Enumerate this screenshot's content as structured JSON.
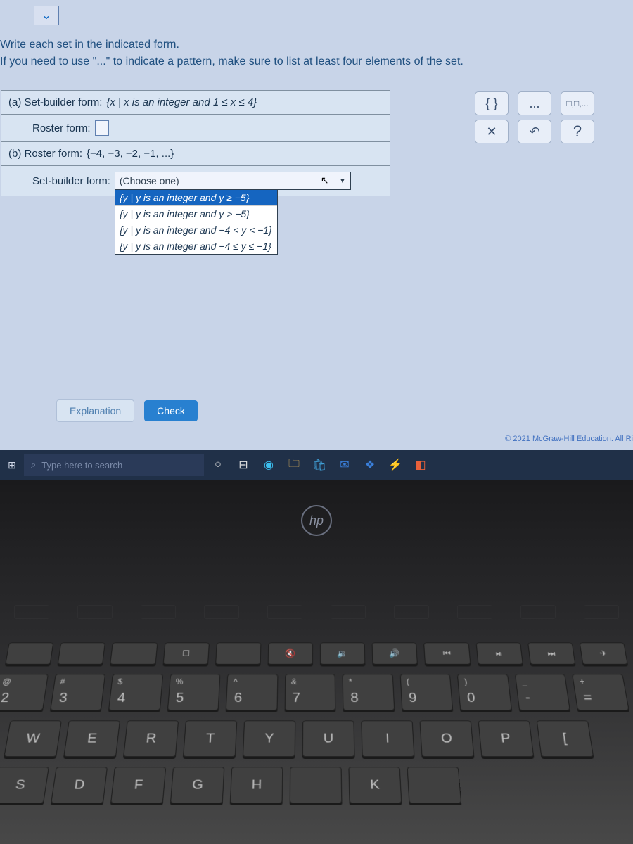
{
  "instructions": {
    "line1_pre": "Write each ",
    "line1_underline": "set",
    "line1_post": " in the indicated form.",
    "line2": "If you need to use \"...\" to indicate a pattern, make sure to list at least four elements of the set."
  },
  "parts": {
    "a_label": "(a)  Set-builder form:",
    "a_value": "{x | x is an integer and 1 ≤ x ≤ 4}",
    "a_roster_label": "Roster form:",
    "b_label": "(b)  Roster form:",
    "b_value": "{−4, −3, −2, −1, ...}",
    "b_sb_label": "Set-builder form:"
  },
  "dropdown": {
    "selected": "(Choose one)",
    "options": [
      "{y | y is an integer and y ≥ −5}",
      "{y | y is an integer and y > −5}",
      "{y | y is an integer and −4 < y < −1}",
      "{y | y is an integer and −4 ≤ y ≤ −1}"
    ]
  },
  "tools": {
    "set_braces": "{ }",
    "ellipsis": "...",
    "pair": "□,□,...",
    "clear": "✕",
    "reset": "↶",
    "help": "?"
  },
  "buttons": {
    "explanation": "Explanation",
    "check": "Check"
  },
  "copyright": "© 2021 McGraw-Hill Education. All Ri",
  "taskbar": {
    "search_placeholder": "Type here to search"
  },
  "hp": "hp",
  "keys": {
    "fn_row": [
      "",
      "",
      "",
      "☐",
      "",
      "🔇",
      "🔉",
      "🔊",
      "⏮",
      "⏯",
      "⏭",
      "✈"
    ],
    "num_row": [
      {
        "top": "@",
        "main": "2"
      },
      {
        "top": "#",
        "main": "3"
      },
      {
        "top": "$",
        "main": "4"
      },
      {
        "top": "%",
        "main": "5"
      },
      {
        "top": "^",
        "main": "6"
      },
      {
        "top": "&",
        "main": "7"
      },
      {
        "top": "*",
        "main": "8"
      },
      {
        "top": "(",
        "main": "9"
      },
      {
        "top": ")",
        "main": "0"
      },
      {
        "top": "_",
        "main": "-"
      },
      {
        "top": "+",
        "main": "="
      }
    ],
    "letter_row1": [
      "W",
      "E",
      "R",
      "T",
      "Y",
      "U",
      "I",
      "O",
      "P",
      "["
    ],
    "letter_row2": [
      "S",
      "D",
      "F",
      "G",
      "H",
      "",
      "K",
      ""
    ]
  }
}
